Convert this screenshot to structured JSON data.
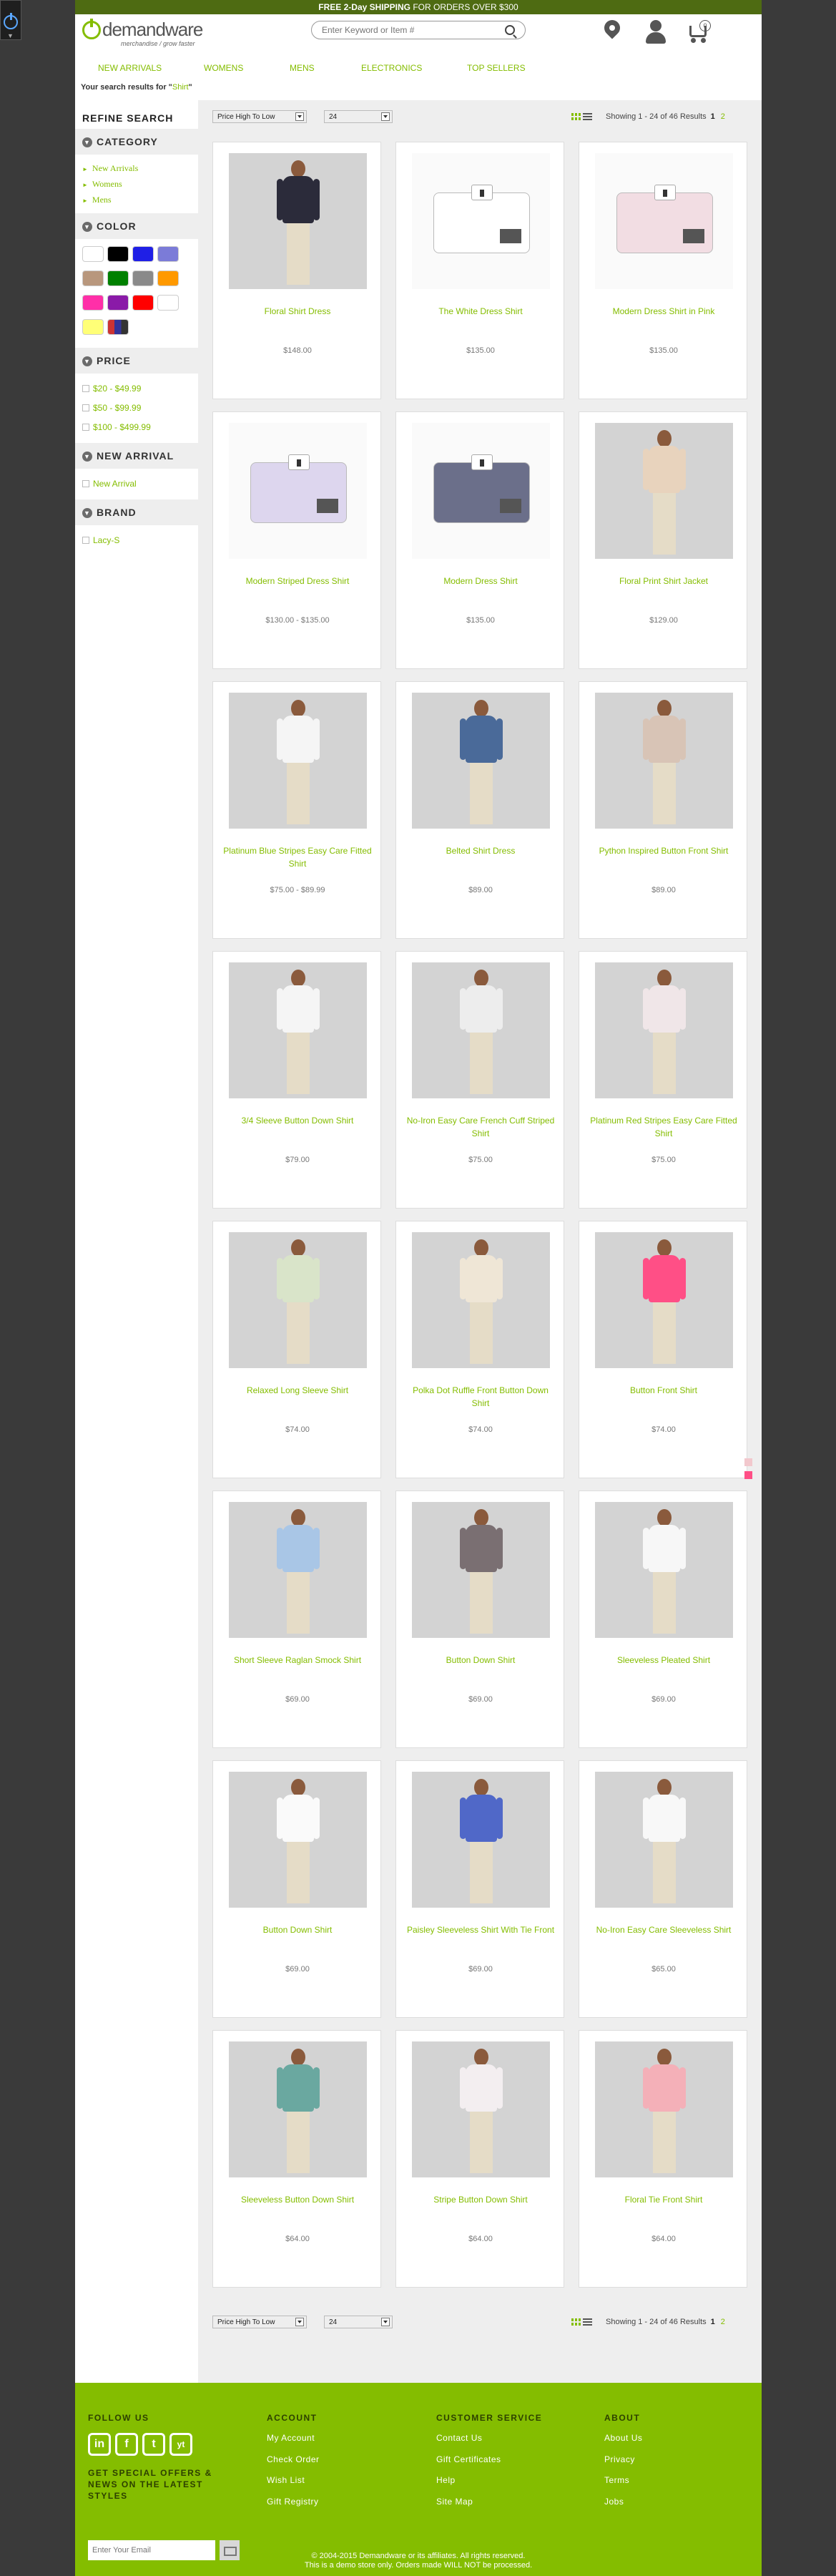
{
  "banner": {
    "strong": "FREE 2-Day SHIPPING",
    "rest": " FOR ORDERS OVER $300"
  },
  "logo": {
    "name": "demandware",
    "tagline": "merchandise / grow faster"
  },
  "search": {
    "placeholder": "Enter Keyword or Item #"
  },
  "cart": {
    "count": "0"
  },
  "nav": [
    "NEW ARRIVALS",
    "WOMENS",
    "MENS",
    "ELECTRONICS",
    "TOP SELLERS"
  ],
  "results": {
    "prefix": "Your search results for \"",
    "term": "Shirt",
    "suffix": "\""
  },
  "refine": {
    "title": "REFINE SEARCH",
    "category": {
      "label": "CATEGORY",
      "items": [
        "New Arrivals",
        "Womens",
        "Mens"
      ]
    },
    "color": {
      "label": "COLOR",
      "swatches": [
        "#ffffff",
        "#000000",
        "#1f1fe6",
        "#7b7bd8",
        "#b8977d",
        "#008000",
        "#8a8a8a",
        "#ff9900",
        "#ff2fa8",
        "#8a1aa8",
        "#ff0000",
        "#ffffff",
        "#ffff77",
        "multi"
      ]
    },
    "price": {
      "label": "PRICE",
      "items": [
        "$20 - $49.99",
        "$50 - $99.99",
        "$100 - $499.99"
      ]
    },
    "new_arrival": {
      "label": "NEW ARRIVAL",
      "items": [
        "New Arrival"
      ]
    },
    "brand": {
      "label": "BRAND",
      "items": [
        "Lacy-S"
      ]
    }
  },
  "toolbar": {
    "sort": "Price High To Low",
    "per_page": "24",
    "showing": "Showing 1 - 24 of 46 Results",
    "current_page": "1",
    "next_page": "2"
  },
  "products": [
    {
      "name": "Floral Shirt Dress",
      "price": "$148.00"
    },
    {
      "name": "The White Dress Shirt",
      "price": "$135.00"
    },
    {
      "name": "Modern Dress Shirt in Pink",
      "price": "$135.00"
    },
    {
      "name": "Modern Striped Dress Shirt",
      "price": "$130.00 - $135.00"
    },
    {
      "name": "Modern Dress Shirt",
      "price": "$135.00"
    },
    {
      "name": "Floral Print Shirt Jacket",
      "price": "$129.00"
    },
    {
      "name": "Platinum Blue Stripes Easy Care Fitted Shirt",
      "price": "$75.00 - $89.99"
    },
    {
      "name": "Belted Shirt Dress",
      "price": "$89.00"
    },
    {
      "name": "Python Inspired Button Front Shirt",
      "price": "$89.00"
    },
    {
      "name": "3/4 Sleeve Button Down Shirt",
      "price": "$79.00"
    },
    {
      "name": "No-Iron Easy Care French Cuff Striped Shirt",
      "price": "$75.00"
    },
    {
      "name": "Platinum Red Stripes Easy Care Fitted Shirt",
      "price": "$75.00"
    },
    {
      "name": "Relaxed Long Sleeve Shirt",
      "price": "$74.00"
    },
    {
      "name": "Polka Dot Ruffle Front Button Down Shirt",
      "price": "$74.00"
    },
    {
      "name": "Button Front Shirt",
      "price": "$74.00"
    },
    {
      "name": "Short Sleeve Raglan Smock Shirt",
      "price": "$69.00"
    },
    {
      "name": "Button Down Shirt",
      "price": "$69.00"
    },
    {
      "name": "Sleeveless Pleated Shirt",
      "price": "$69.00"
    },
    {
      "name": "Button Down Shirt",
      "price": "$69.00"
    },
    {
      "name": "Paisley Sleeveless Shirt With Tie Front",
      "price": "$69.00"
    },
    {
      "name": "No-Iron Easy Care Sleeveless Shirt",
      "price": "$65.00"
    },
    {
      "name": "Sleeveless Button Down Shirt",
      "price": "$64.00"
    },
    {
      "name": "Stripe Button Down Shirt",
      "price": "$64.00"
    },
    {
      "name": "Floral Tie Front Shirt",
      "price": "$64.00"
    }
  ],
  "product_colors": [
    "#2b2b3a",
    "#ffffff",
    "#f2dde3",
    "#ddd6ee",
    "#6b6f8a",
    "#e8d3bd",
    "#f5f5f5",
    "#4a6a99",
    "#d8c4b6",
    "#f5f5f5",
    "#ededed",
    "#f0e6e8",
    "#d9e4c9",
    "#efe6d6",
    "#ff4f86",
    "#a9c6e6",
    "#7a6f72",
    "#f7f7f7",
    "#fafafa",
    "#5068c8",
    "#f8f8f8",
    "#6aa8a0",
    "#f3eef0",
    "#f4b0b8"
  ],
  "footer": {
    "follow": "FOLLOW US",
    "social": [
      "in",
      "f",
      "t",
      "yt"
    ],
    "offers": "GET SPECIAL OFFERS & NEWS ON THE LATEST STYLES",
    "email_placeholder": "Enter Your Email",
    "account": {
      "label": "ACCOUNT",
      "links": [
        "My Account",
        "Check Order",
        "Wish List",
        "Gift Registry"
      ]
    },
    "service": {
      "label": "CUSTOMER SERVICE",
      "links": [
        "Contact Us",
        "Gift Certificates",
        "Help",
        "Site Map"
      ]
    },
    "about": {
      "label": "ABOUT",
      "links": [
        "About Us",
        "Privacy",
        "Terms",
        "Jobs"
      ]
    },
    "copyright1": "© 2004-2015 Demandware or its affiliates. All rights reserved.",
    "copyright2": "This is a demo store only. Orders made WILL NOT be processed."
  }
}
